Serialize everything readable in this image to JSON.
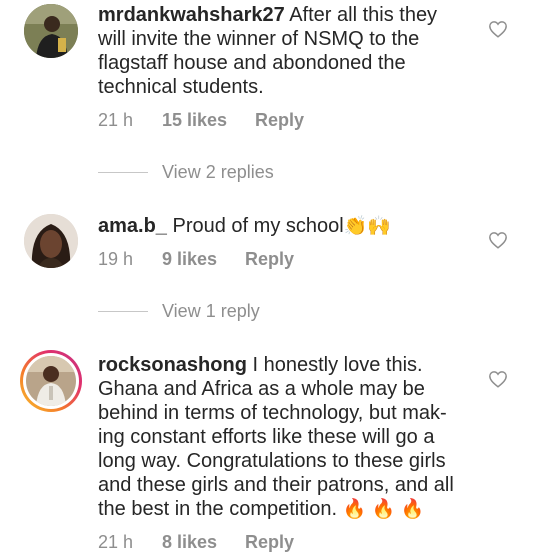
{
  "comments": [
    {
      "username": "mrdankwahshark27",
      "text": "After all this they will invite the winner of NSMQ to the flagstaff house and abondoned the technical students.",
      "time": "21 h",
      "likes": "15 likes",
      "reply": "Reply",
      "view_replies": "View 2 replies",
      "avatar_icon": "profile-photo"
    },
    {
      "username": "ama.b_",
      "text": "Proud of my school",
      "emoji": "👏🙌",
      "time": "19 h",
      "likes": "9 likes",
      "reply": "Reply",
      "view_replies": "View 1 reply",
      "avatar_icon": "profile-photo"
    },
    {
      "username": "rocksonashong",
      "text": "I honestly love this. Ghana and Africa as a whole may be behind in terms of technology, but mak-ing constant efforts like these will go a long way. Congratulations to these girls and these girls and their patrons, and all the best in the competition.",
      "emoji": "🔥 🔥 🔥",
      "time": "21 h",
      "likes": "8 likes",
      "reply": "Reply",
      "avatar_icon": "profile-photo-story-ring"
    }
  ],
  "colors": {
    "text": "#262626",
    "meta": "#8e8e8e",
    "divider": "#c7c7c7"
  }
}
